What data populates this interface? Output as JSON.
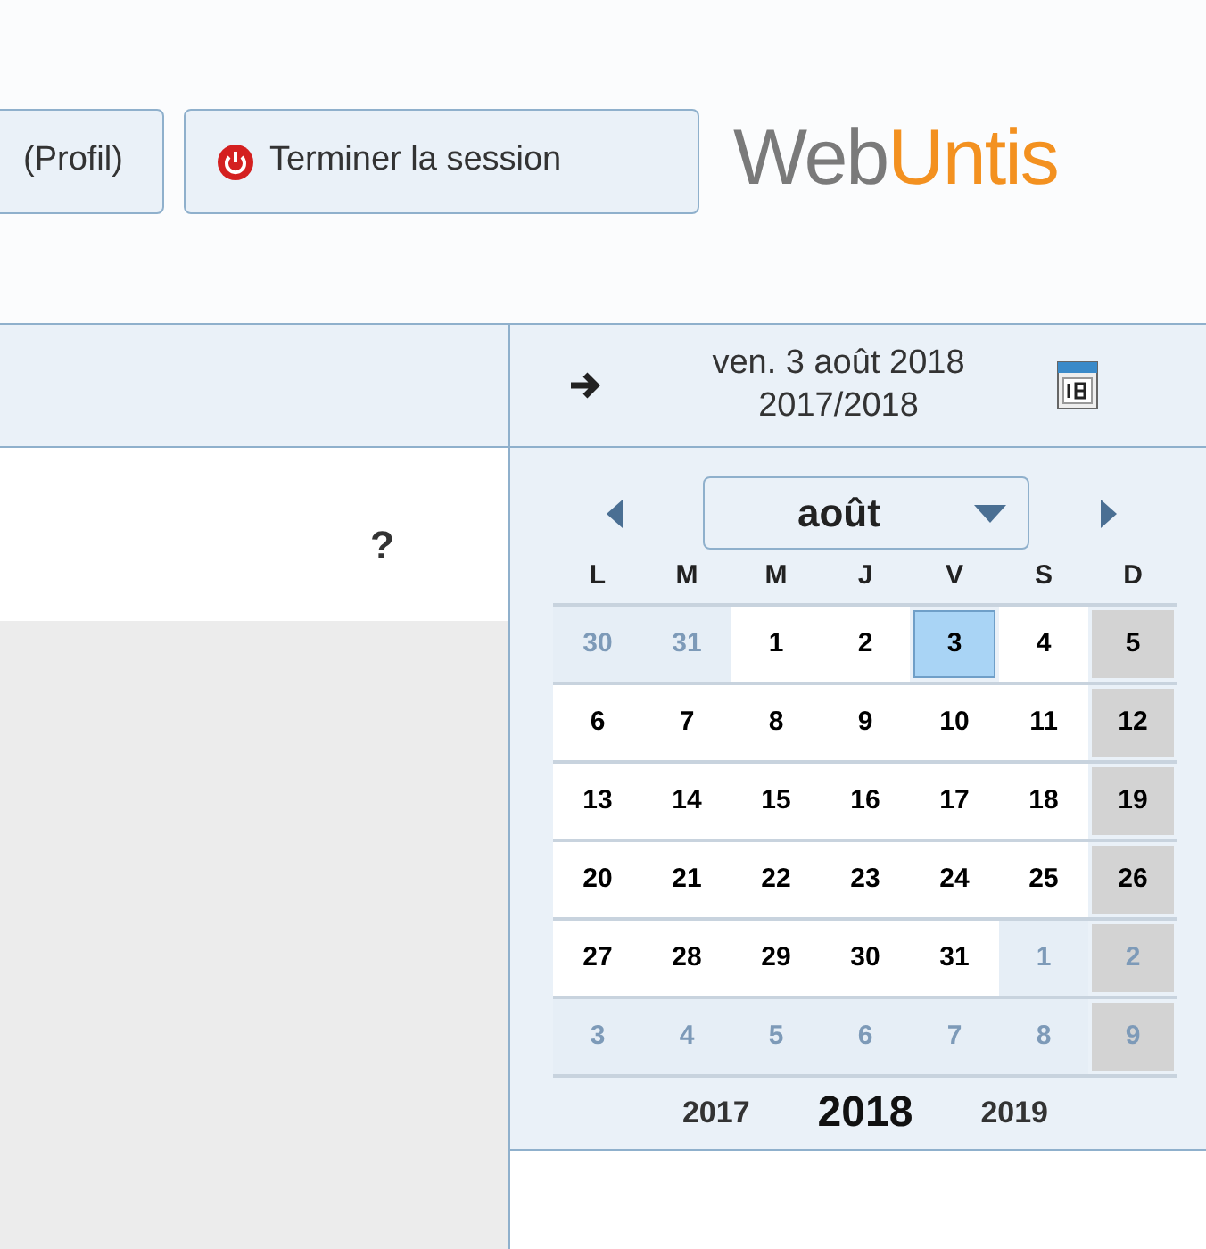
{
  "header": {
    "profile_button": "(Profil)",
    "logout_button": "Terminer la session",
    "logo": {
      "part1": "Web",
      "part2": "Untis"
    }
  },
  "date_bar": {
    "date": "ven. 3 août 2018",
    "school_year": "2017/2018"
  },
  "help": "?",
  "calendar": {
    "month": "août",
    "weekdays": [
      "L",
      "M",
      "M",
      "J",
      "V",
      "S",
      "D"
    ],
    "weeks": [
      [
        {
          "label": "30",
          "outside": true,
          "selected": false
        },
        {
          "label": "31",
          "outside": true,
          "selected": false
        },
        {
          "label": "1",
          "outside": false,
          "selected": false
        },
        {
          "label": "2",
          "outside": false,
          "selected": false
        },
        {
          "label": "3",
          "outside": false,
          "selected": true
        },
        {
          "label": "4",
          "outside": false,
          "selected": false
        },
        {
          "label": "5",
          "outside": false,
          "selected": false
        }
      ],
      [
        {
          "label": "6",
          "outside": false,
          "selected": false
        },
        {
          "label": "7",
          "outside": false,
          "selected": false
        },
        {
          "label": "8",
          "outside": false,
          "selected": false
        },
        {
          "label": "9",
          "outside": false,
          "selected": false
        },
        {
          "label": "10",
          "outside": false,
          "selected": false
        },
        {
          "label": "11",
          "outside": false,
          "selected": false
        },
        {
          "label": "12",
          "outside": false,
          "selected": false
        }
      ],
      [
        {
          "label": "13",
          "outside": false,
          "selected": false
        },
        {
          "label": "14",
          "outside": false,
          "selected": false
        },
        {
          "label": "15",
          "outside": false,
          "selected": false
        },
        {
          "label": "16",
          "outside": false,
          "selected": false
        },
        {
          "label": "17",
          "outside": false,
          "selected": false
        },
        {
          "label": "18",
          "outside": false,
          "selected": false
        },
        {
          "label": "19",
          "outside": false,
          "selected": false
        }
      ],
      [
        {
          "label": "20",
          "outside": false,
          "selected": false
        },
        {
          "label": "21",
          "outside": false,
          "selected": false
        },
        {
          "label": "22",
          "outside": false,
          "selected": false
        },
        {
          "label": "23",
          "outside": false,
          "selected": false
        },
        {
          "label": "24",
          "outside": false,
          "selected": false
        },
        {
          "label": "25",
          "outside": false,
          "selected": false
        },
        {
          "label": "26",
          "outside": false,
          "selected": false
        }
      ],
      [
        {
          "label": "27",
          "outside": false,
          "selected": false
        },
        {
          "label": "28",
          "outside": false,
          "selected": false
        },
        {
          "label": "29",
          "outside": false,
          "selected": false
        },
        {
          "label": "30",
          "outside": false,
          "selected": false
        },
        {
          "label": "31",
          "outside": false,
          "selected": false
        },
        {
          "label": "1",
          "outside": true,
          "selected": false
        },
        {
          "label": "2",
          "outside": true,
          "selected": false
        }
      ],
      [
        {
          "label": "3",
          "outside": true,
          "selected": false
        },
        {
          "label": "4",
          "outside": true,
          "selected": false
        },
        {
          "label": "5",
          "outside": true,
          "selected": false
        },
        {
          "label": "6",
          "outside": true,
          "selected": false
        },
        {
          "label": "7",
          "outside": true,
          "selected": false
        },
        {
          "label": "8",
          "outside": true,
          "selected": false
        },
        {
          "label": "9",
          "outside": true,
          "selected": false
        }
      ]
    ],
    "years": [
      {
        "label": "2017",
        "selected": false
      },
      {
        "label": "2018",
        "selected": true
      },
      {
        "label": "2019",
        "selected": false
      }
    ]
  }
}
